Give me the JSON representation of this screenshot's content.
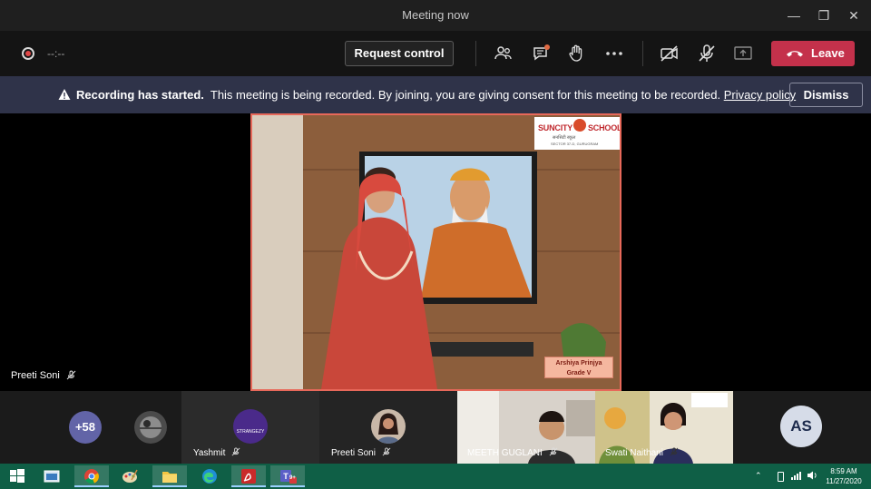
{
  "window": {
    "title": "Meeting now",
    "minimize_glyph": "—",
    "restore_glyph": "❐",
    "close_glyph": "✕"
  },
  "toolbar": {
    "timer": "--:--",
    "request_control_label": "Request control",
    "leave_label": "Leave",
    "icons": [
      "participants-icon",
      "chat-icon",
      "raise-hand-icon",
      "more-options-icon",
      "camera-off-icon",
      "mic-off-icon",
      "share-screen-icon"
    ]
  },
  "banner": {
    "bold_text": "Recording has started.",
    "text": "This meeting is being recorded. By joining, you are giving consent for this meeting to be recorded.",
    "link_text": "Privacy policy",
    "dismiss_label": "Dismiss"
  },
  "stage": {
    "speaker_name": "Preeti Soni",
    "logo": {
      "school_name_left": "SUNCITY",
      "school_name_right": "SCHOOL",
      "subtitle": "सनसिटी स्कूल",
      "address": "SECTOR 37-D, GURUGRAM"
    },
    "student_tag": {
      "name": "Arshiya Prinjya",
      "grade": "Grade V"
    }
  },
  "participants": [
    {
      "label": "+58",
      "type": "overflow"
    },
    {
      "name": "",
      "type": "avatar-image"
    },
    {
      "name": "Yashmit",
      "avatar_text": "STRANGEZY",
      "type": "logo-avatar"
    },
    {
      "name": "Preeti Soni",
      "type": "photo-avatar"
    },
    {
      "name": "MEETH GUGLANI",
      "type": "video"
    },
    {
      "name": "Swati Naithani",
      "type": "video"
    },
    {
      "initials": "AS",
      "type": "initials"
    }
  ],
  "taskbar": {
    "apps": [
      "windows-start-icon",
      "explorer-window-icon",
      "chrome-icon",
      "paint-icon",
      "file-explorer-icon",
      "edge-icon",
      "pdf-reader-icon",
      "teams-icon"
    ],
    "teams_badge": "9+",
    "time": "8:59 AM",
    "date": "11/27/2020"
  },
  "colors": {
    "leave_red": "#c4314b",
    "banner_bg": "#2f3349",
    "teams_purple": "#6264a7",
    "taskbar_green": "#0f5f46"
  }
}
